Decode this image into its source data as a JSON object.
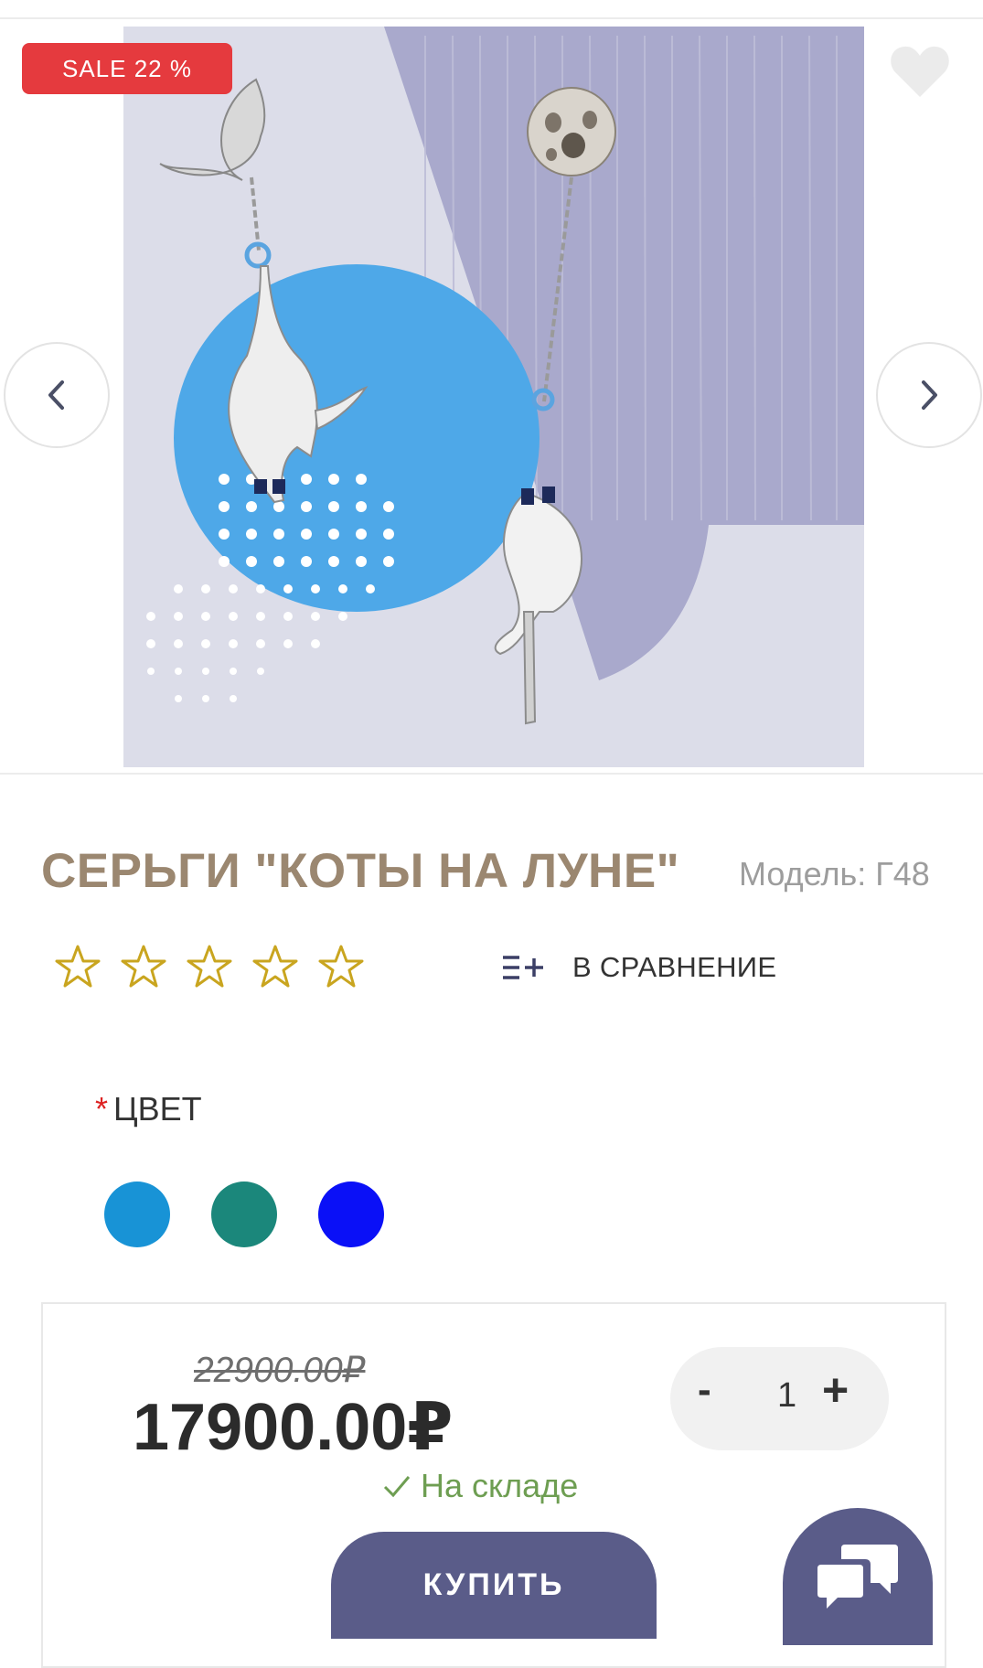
{
  "gallery": {
    "sale_badge": "SALE 22 %",
    "image_alt": "Earrings Cats on the Moon"
  },
  "product": {
    "title": "СЕРЬГИ \"КОТЫ НА ЛУНЕ\"",
    "model": "Модель: Г48",
    "rating": 0,
    "rating_max": 5,
    "compare_label": "В СРАВНЕНИЕ"
  },
  "options": {
    "color_required_mark": "*",
    "color_label": "ЦВЕТ",
    "colors": [
      "#1893d6",
      "#1b877b",
      "#0a10f7"
    ]
  },
  "purchase": {
    "old_price": "22900.00₽",
    "price": "17900.00₽",
    "quantity": "1",
    "minus_label": "-",
    "plus_label": "+",
    "stock_status": "На складе",
    "buy_label": "КУПИТЬ"
  },
  "icons": {
    "wishlist": "heart-icon",
    "prev": "chevron-left-icon",
    "next": "chevron-right-icon",
    "compare": "compare-list-icon",
    "stock": "check-icon",
    "chat": "chat-bubbles-icon"
  },
  "colors": {
    "title": "#9b8770",
    "sale_badge": "#e53a3e",
    "star": "#c9a51f",
    "in_stock": "#6e9e52",
    "button": "#5a5c89"
  }
}
